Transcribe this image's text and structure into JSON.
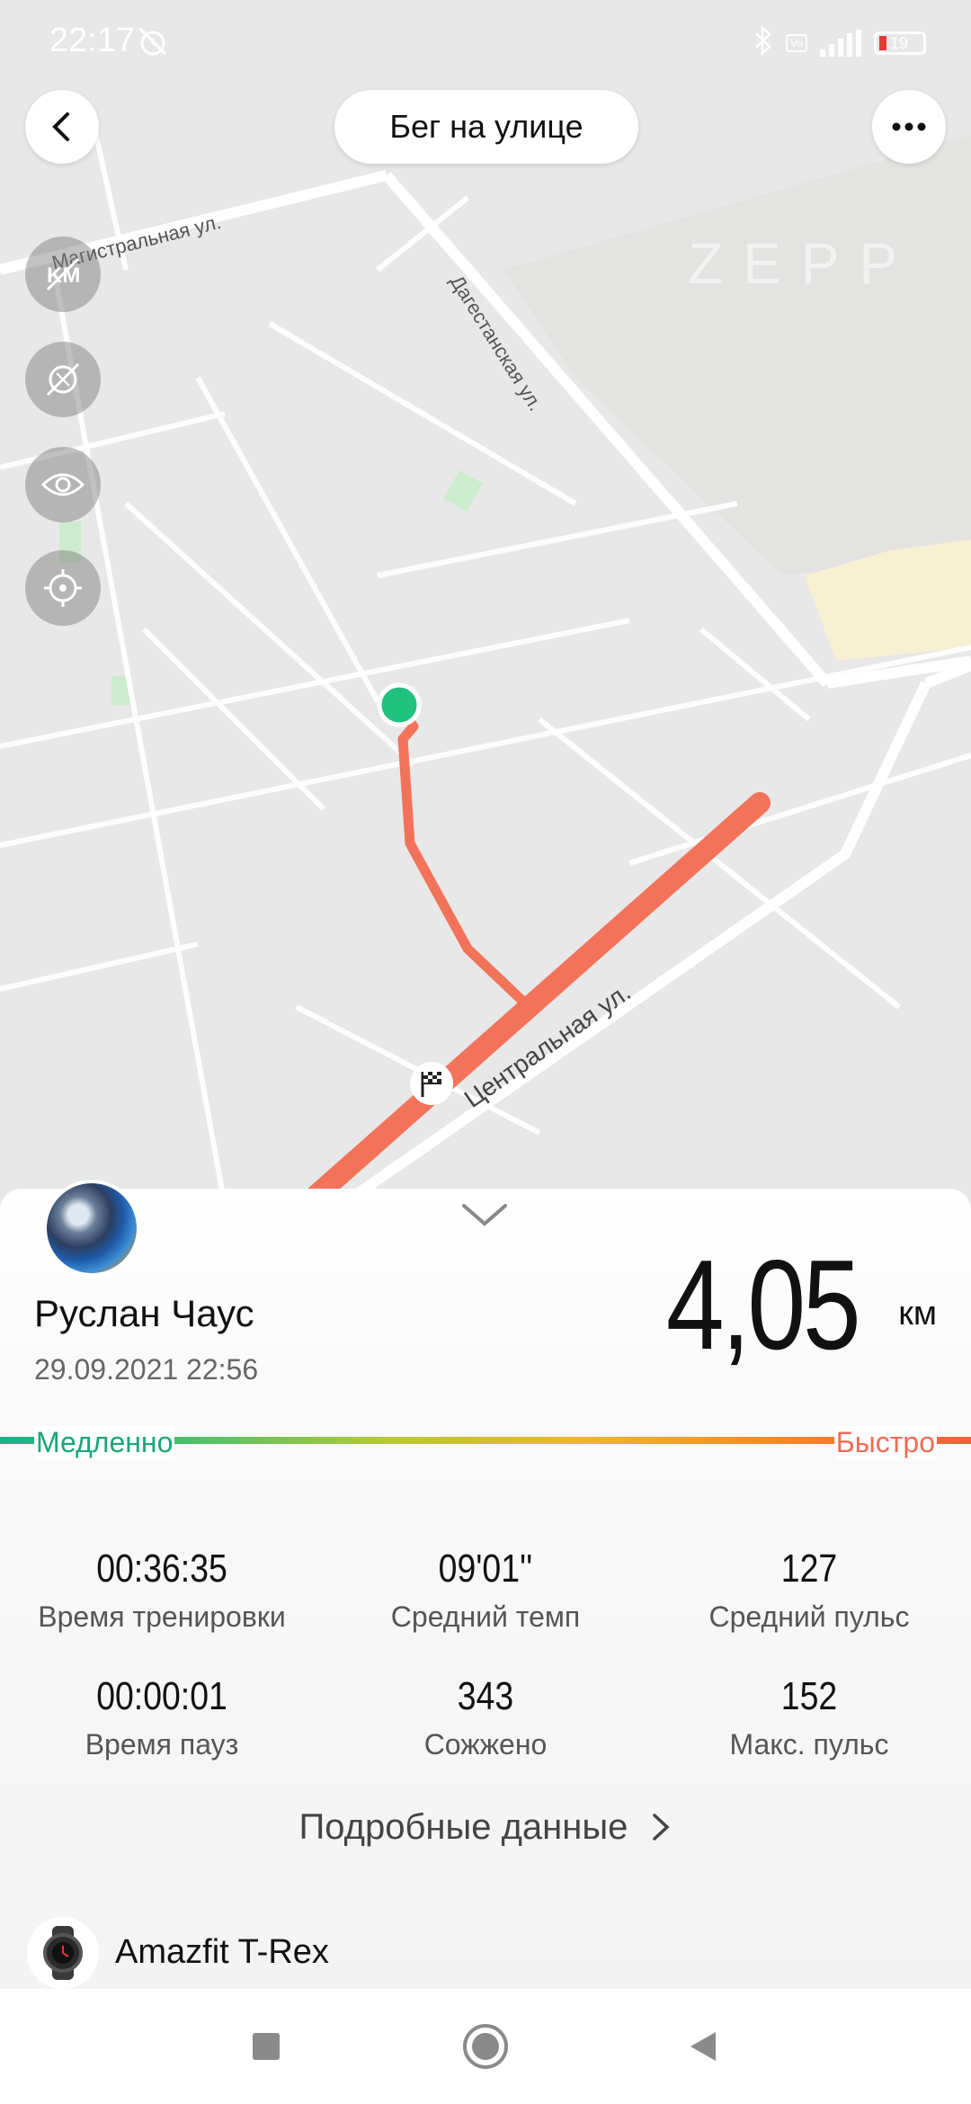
{
  "status_bar": {
    "time": "22:17",
    "battery": "19"
  },
  "header": {
    "title": "Бег на улице"
  },
  "map": {
    "streets": [
      "Магистральная ул.",
      "Дагестанская ул.",
      "Центральная ул."
    ],
    "watermark": "ZEPP"
  },
  "summary": {
    "user_name": "Руслан Чаус",
    "date": "29.09.2021 22:56",
    "distance": "4,05",
    "distance_unit": "км",
    "pace_slow": "Медленно",
    "pace_fast": "Быстро"
  },
  "stats": [
    {
      "value": "00:36:35",
      "label": "Время тренировки"
    },
    {
      "value": "09'01''",
      "label": "Средний темп"
    },
    {
      "value": "127",
      "label": "Средний пульс"
    },
    {
      "value": "00:00:01",
      "label": "Время пауз"
    },
    {
      "value": "343",
      "label": "Сожжено"
    },
    {
      "value": "152",
      "label": "Макс. пульс"
    }
  ],
  "details_link": "Подробные данные",
  "device": {
    "name": "Amazfit T-Rex"
  },
  "colors": {
    "route": "#f2735a",
    "start": "#21c17e",
    "pace_slow": "#19a57a",
    "pace_fast": "#f06c55"
  }
}
